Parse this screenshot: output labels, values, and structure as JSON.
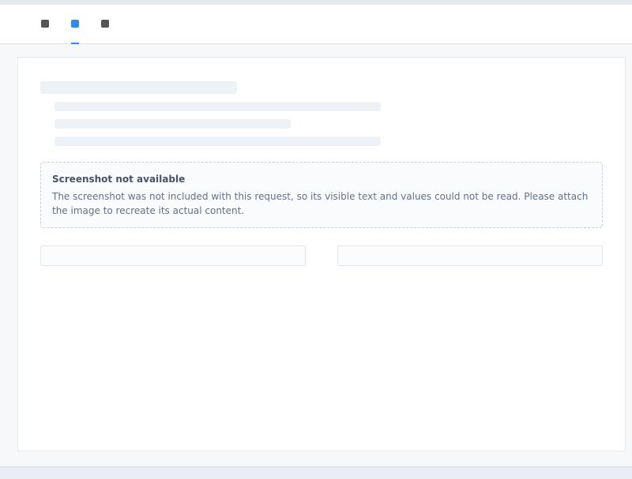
{
  "notice": {
    "heading": "Screenshot not available",
    "body": "The screenshot was not included with this request, so its visible text and values could not be read. Please attach the image to recreate its actual content."
  }
}
